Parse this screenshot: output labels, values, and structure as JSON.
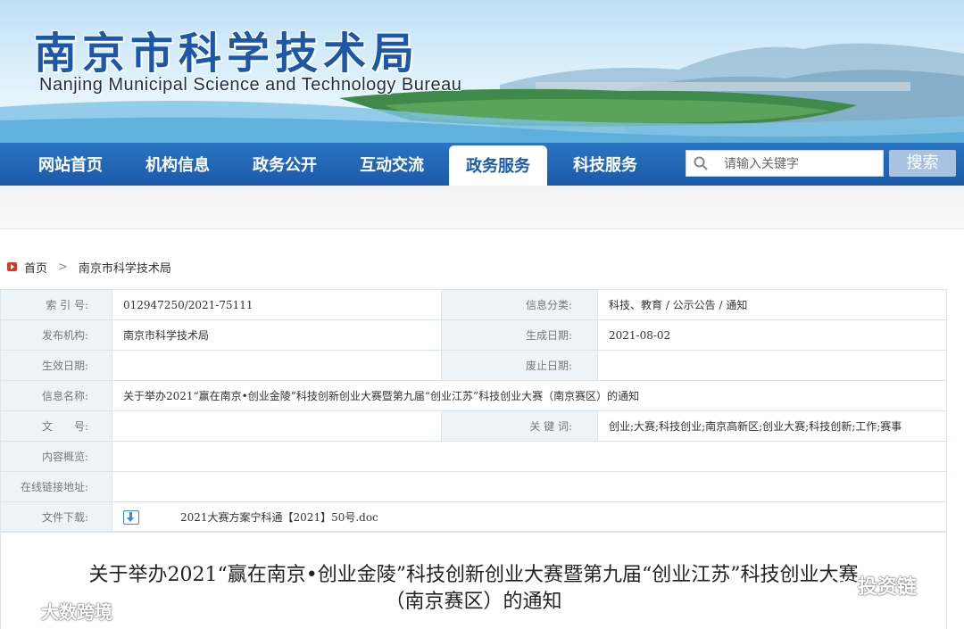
{
  "banner": {
    "title": "南京市科学技术局",
    "subtitle": "Nanjing Municipal Science and Technology Bureau"
  },
  "nav": {
    "items": [
      "网站首页",
      "机构信息",
      "政务公开",
      "互动交流",
      "政务服务",
      "科技服务"
    ],
    "active_index": 4,
    "search_placeholder": "请输入关键字",
    "search_button": "搜索"
  },
  "breadcrumb": {
    "home": "首页",
    "separator": ">",
    "current": "南京市科学技术局"
  },
  "info": {
    "index_no_label": "索 引 号:",
    "index_no": "012947250/2021-75111",
    "category_label": "信息分类:",
    "category": "科技、教育 / 公示公告 / 通知",
    "publisher_label": "发布机构:",
    "publisher": "南京市科学技术局",
    "created_label": "生成日期:",
    "created": "2021-08-02",
    "effective_label": "生效日期:",
    "effective": "",
    "expire_label": "废止日期:",
    "expire": "",
    "name_label": "信息名称:",
    "name": "关于举办2021“赢在南京•创业金陵”科技创新创业大赛暨第九届“创业江苏”科技创业大赛（南京赛区）的通知",
    "doc_no_label": "文　　号:",
    "doc_no": "",
    "keywords_label": "关 键 词:",
    "keywords": "创业;大赛;科技创业;南京高新区;创业大赛;科技创新;工作;赛事",
    "summary_label": "内容概览:",
    "summary": "",
    "link_label": "在线链接地址:",
    "link": "",
    "download_label": "文件下载:",
    "download_file": "2021大赛方案宁科通【2021】50号.doc"
  },
  "article": {
    "title_line1": "关于举办2021“赢在南京•创业金陵”科技创新创业大赛暨第九届“创业江苏”科技创业大赛",
    "title_line2": "（南京赛区）的通知"
  },
  "watermarks": {
    "left": "大数跨境",
    "right": "投资链"
  },
  "colors": {
    "nav_blue": "#1b5aa8",
    "label_bg": "#eef3f8",
    "title_blue": "#1d57a8"
  }
}
